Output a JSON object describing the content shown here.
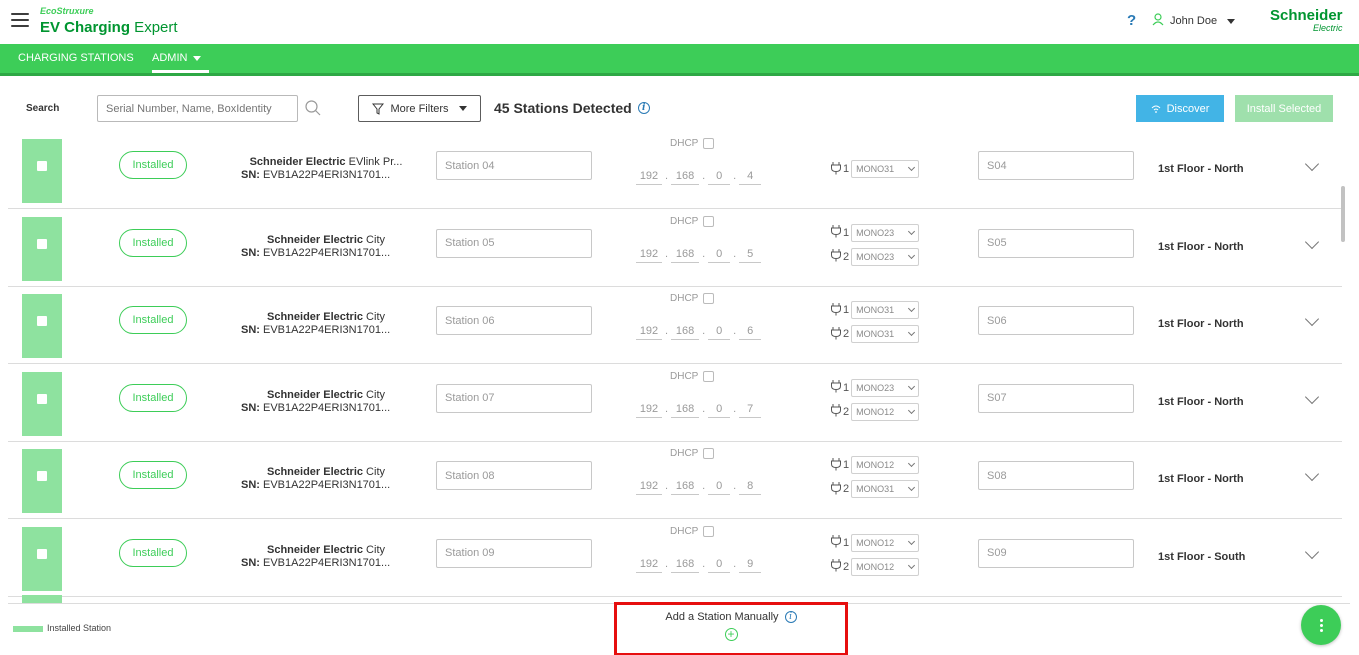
{
  "header": {
    "brand_small": "EcoStruxure",
    "brand_title_bold": "EV Charging",
    "brand_title_rest": " Expert",
    "help": "?",
    "user_name": "John Doe",
    "logo_main": "Schneider",
    "logo_sub": "Electric"
  },
  "nav": {
    "stations": "CHARGING STATIONS",
    "admin": "ADMIN"
  },
  "toolbar": {
    "search_label": "Search",
    "search_placeholder": "Serial Number, Name, BoxIdentity",
    "more_filters": "More Filters",
    "detected": "45 Stations Detected",
    "discover": "Discover",
    "install_selected": "Install Selected"
  },
  "rows": [
    {
      "status": "Installed",
      "brand": "Schneider Electric",
      "model": " EVlink Pr...",
      "sn_label": "SN:",
      "sn": " EVB1A22P4ERI3N1701...",
      "name": "Station 04",
      "dhcp": "DHCP",
      "ip": [
        "192",
        "168",
        "0",
        "4"
      ],
      "connectors": [
        {
          "num": "1",
          "type": "MONO31"
        }
      ],
      "code": "S04",
      "location": "1st Floor - North"
    },
    {
      "status": "Installed",
      "brand": "Schneider Electric",
      "model": " City",
      "sn_label": "SN:",
      "sn": " EVB1A22P4ERI3N1701...",
      "name": "Station 05",
      "dhcp": "DHCP",
      "ip": [
        "192",
        "168",
        "0",
        "5"
      ],
      "connectors": [
        {
          "num": "1",
          "type": "MONO23"
        },
        {
          "num": "2",
          "type": "MONO23"
        }
      ],
      "code": "S05",
      "location": "1st Floor - North"
    },
    {
      "status": "Installed",
      "brand": "Schneider Electric",
      "model": " City",
      "sn_label": "SN:",
      "sn": " EVB1A22P4ERI3N1701...",
      "name": "Station 06",
      "dhcp": "DHCP",
      "ip": [
        "192",
        "168",
        "0",
        "6"
      ],
      "connectors": [
        {
          "num": "1",
          "type": "MONO31"
        },
        {
          "num": "2",
          "type": "MONO31"
        }
      ],
      "code": "S06",
      "location": "1st Floor - North"
    },
    {
      "status": "Installed",
      "brand": "Schneider Electric",
      "model": " City",
      "sn_label": "SN:",
      "sn": " EVB1A22P4ERI3N1701...",
      "name": "Station 07",
      "dhcp": "DHCP",
      "ip": [
        "192",
        "168",
        "0",
        "7"
      ],
      "connectors": [
        {
          "num": "1",
          "type": "MONO23"
        },
        {
          "num": "2",
          "type": "MONO12"
        }
      ],
      "code": "S07",
      "location": "1st Floor - North"
    },
    {
      "status": "Installed",
      "brand": "Schneider Electric",
      "model": " City",
      "sn_label": "SN:",
      "sn": " EVB1A22P4ERI3N1701...",
      "name": "Station 08",
      "dhcp": "DHCP",
      "ip": [
        "192",
        "168",
        "0",
        "8"
      ],
      "connectors": [
        {
          "num": "1",
          "type": "MONO12"
        },
        {
          "num": "2",
          "type": "MONO31"
        }
      ],
      "code": "S08",
      "location": "1st Floor - North"
    },
    {
      "status": "Installed",
      "brand": "Schneider Electric",
      "model": " City",
      "sn_label": "SN:",
      "sn": " EVB1A22P4ERI3N1701...",
      "name": "Station 09",
      "dhcp": "DHCP",
      "ip": [
        "192",
        "168",
        "0",
        "9"
      ],
      "connectors": [
        {
          "num": "1",
          "type": "MONO12"
        },
        {
          "num": "2",
          "type": "MONO12"
        }
      ],
      "code": "S09",
      "location": "1st Floor - South"
    }
  ],
  "footer": {
    "legend": "Installed Station",
    "add_manual": "Add a Station Manually"
  },
  "colors": {
    "brand_green": "#3dcd58",
    "dark_green": "#009530",
    "installed_bar": "#8ee29f",
    "discover_blue": "#42b4e6",
    "highlight_red": "#e60f0f"
  }
}
